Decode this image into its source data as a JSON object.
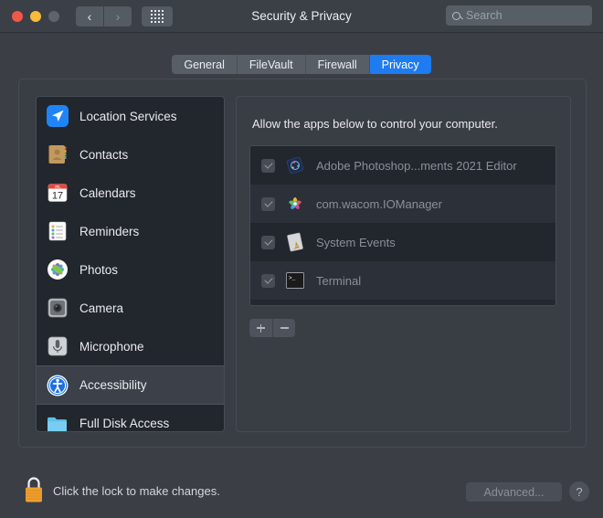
{
  "window": {
    "title": "Security & Privacy",
    "traffic_lights": [
      "close",
      "minimize",
      "zoom"
    ],
    "nav_back": "‹",
    "nav_forward": "›",
    "grid_button": "show-all-icon"
  },
  "search": {
    "placeholder": "Search",
    "value": "",
    "icon": "search-icon"
  },
  "tabs": [
    {
      "label": "General",
      "active": false
    },
    {
      "label": "FileVault",
      "active": false
    },
    {
      "label": "Firewall",
      "active": false
    },
    {
      "label": "Privacy",
      "active": true
    }
  ],
  "sidebar": {
    "items": [
      {
        "label": "Location Services",
        "icon": "location-services-icon",
        "selected": false
      },
      {
        "label": "Contacts",
        "icon": "contacts-icon",
        "selected": false
      },
      {
        "label": "Calendars",
        "icon": "calendars-icon",
        "selected": false
      },
      {
        "label": "Reminders",
        "icon": "reminders-icon",
        "selected": false
      },
      {
        "label": "Photos",
        "icon": "photos-icon",
        "selected": false
      },
      {
        "label": "Camera",
        "icon": "camera-icon",
        "selected": false
      },
      {
        "label": "Microphone",
        "icon": "microphone-icon",
        "selected": false
      },
      {
        "label": "Accessibility",
        "icon": "accessibility-icon",
        "selected": true
      },
      {
        "label": "Full Disk Access",
        "icon": "full-disk-access-icon",
        "selected": false
      }
    ]
  },
  "main": {
    "description": "Allow the apps below to control your computer.",
    "apps": [
      {
        "name": "Adobe Photoshop...ments 2021 Editor",
        "icon": "photoshop-elements-icon",
        "checked": true,
        "enabled": false
      },
      {
        "name": "com.wacom.IOManager",
        "icon": "wacom-icon",
        "checked": true,
        "enabled": false
      },
      {
        "name": "System Events",
        "icon": "system-events-icon",
        "checked": true,
        "enabled": false
      },
      {
        "name": "Terminal",
        "icon": "terminal-icon",
        "checked": true,
        "enabled": false
      }
    ],
    "add_button": "+",
    "remove_button": "−"
  },
  "footer": {
    "lock_icon": "lock-closed-icon",
    "lock_label": "Click the lock to make changes.",
    "advanced_label": "Advanced...",
    "help_label": "?"
  },
  "colors": {
    "accent": "#1f7bf0",
    "window_bg": "#3b3f45",
    "panel_bg": "#393d44",
    "list_bg": "#22262d",
    "lock_orange": "#f0a030"
  }
}
